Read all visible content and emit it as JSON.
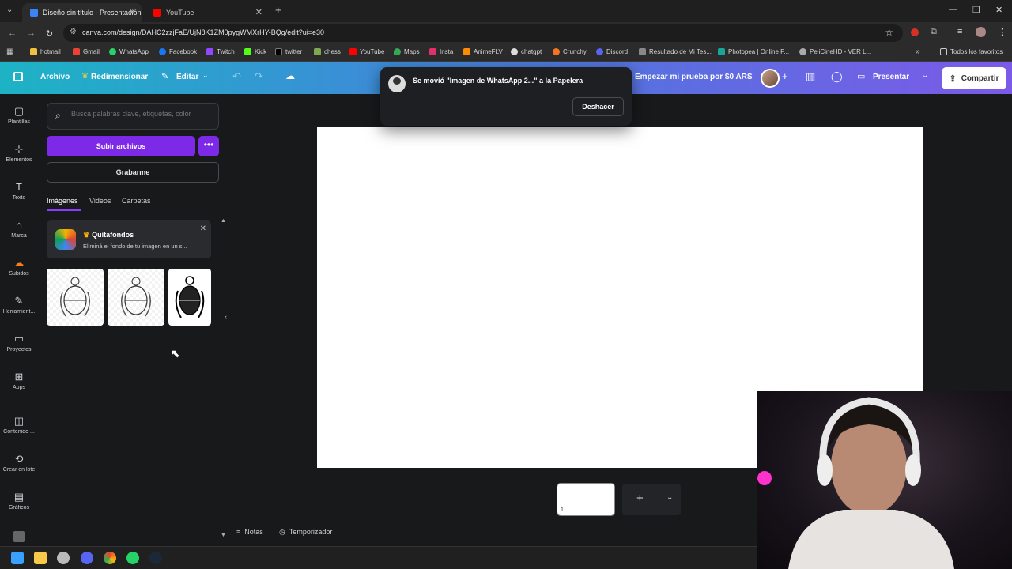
{
  "browser": {
    "tabs": [
      {
        "title": "Diseño sin título - Presentación",
        "active": true
      },
      {
        "title": "YouTube",
        "active": false
      }
    ],
    "new_tab": "+",
    "url": "canva.com/design/DAHC2zzjFaE/UjN8K1ZM0pygWMXrHY-BQg/edit?ui=e30",
    "bookmarks": [
      "hotmail",
      "Gmail",
      "WhatsApp",
      "Facebook",
      "Twitch",
      "Kick",
      "twitter",
      "chess",
      "YouTube",
      "Maps",
      "Insta",
      "AnimeFLV",
      "chatgpt",
      "Crunchy",
      "Discord",
      "Resultado de Mi Tes...",
      "Photopea | Online P...",
      "PeliCineHD - VER L..."
    ],
    "all_favorites": "Todos los favoritos"
  },
  "header": {
    "file": "Archivo",
    "resize": "Redimensionar",
    "edit": "Editar",
    "trial": "Empezar mi prueba por $0 ARS",
    "present": "Presentar",
    "share": "Compartir"
  },
  "rail": [
    "Plantillas",
    "Elementos",
    "Texto",
    "Marca",
    "Subidos",
    "Herramient...",
    "Proyectos",
    "Apps",
    "Contenido ...",
    "Crear en lote",
    "Gráficos"
  ],
  "panel": {
    "search_placeholder": "Buscá palabras clave, etiquetas, color",
    "upload": "Subir archivos",
    "more": "•••",
    "record": "Grabarme",
    "tabs": [
      "Imágenes",
      "Videos",
      "Carpetas"
    ],
    "promo_title": "Quitafondos",
    "promo_text": "Eliminá el fondo de tu imagen en un s..."
  },
  "toast": {
    "message": "Se movió \"Imagen de WhatsApp 2...\" a la Papelera",
    "undo": "Deshacer"
  },
  "footer": {
    "page_number": "1",
    "notes": "Notas",
    "timer": "Temporizador"
  },
  "colors": {
    "accent_purple": "#7d2ae8",
    "header_start": "#1db3c5",
    "header_end": "#7b5ae8"
  }
}
